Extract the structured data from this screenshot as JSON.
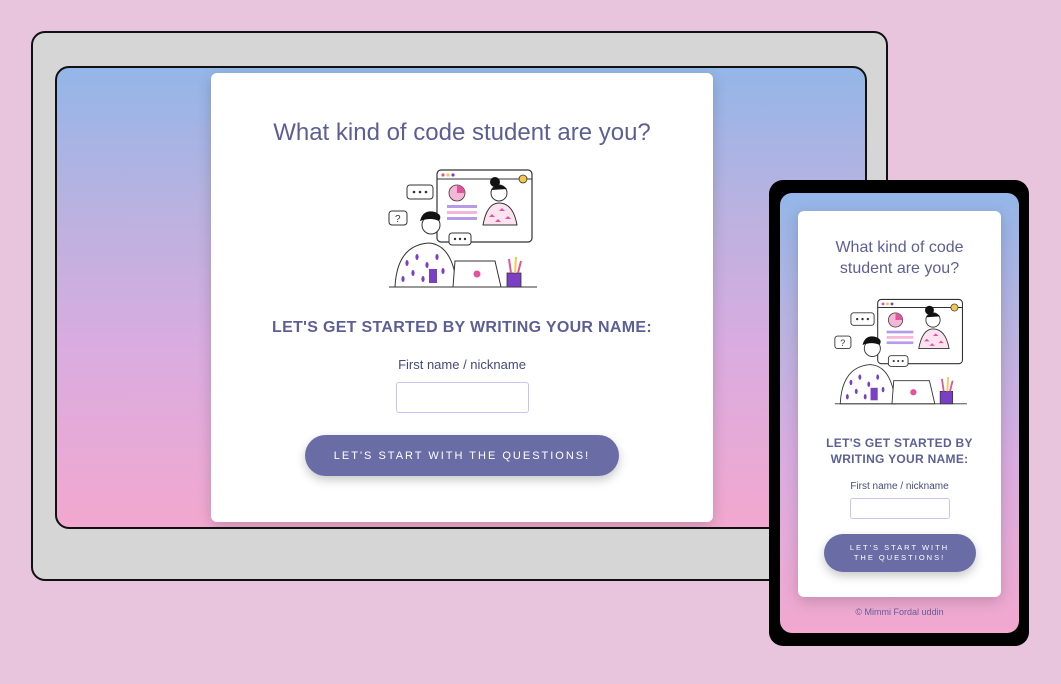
{
  "quiz": {
    "title": "What kind of code student are you?",
    "subheading": "LET'S GET STARTED BY WRITING YOUR NAME:",
    "name_label": "First name / nickname",
    "name_value": "",
    "start_button": "LET'S START WITH THE QUESTIONS!"
  },
  "footer": {
    "copyright": "© Mimmi Fordal uddin"
  },
  "colors": {
    "text": "#5c5f96",
    "button": "#6a6da5",
    "gradient_top": "#93b6e8",
    "gradient_bottom": "#f2a8cf",
    "page_bg": "#e8c5dc"
  },
  "icons": {
    "illustration": "people-video-call-illustration-icon"
  }
}
